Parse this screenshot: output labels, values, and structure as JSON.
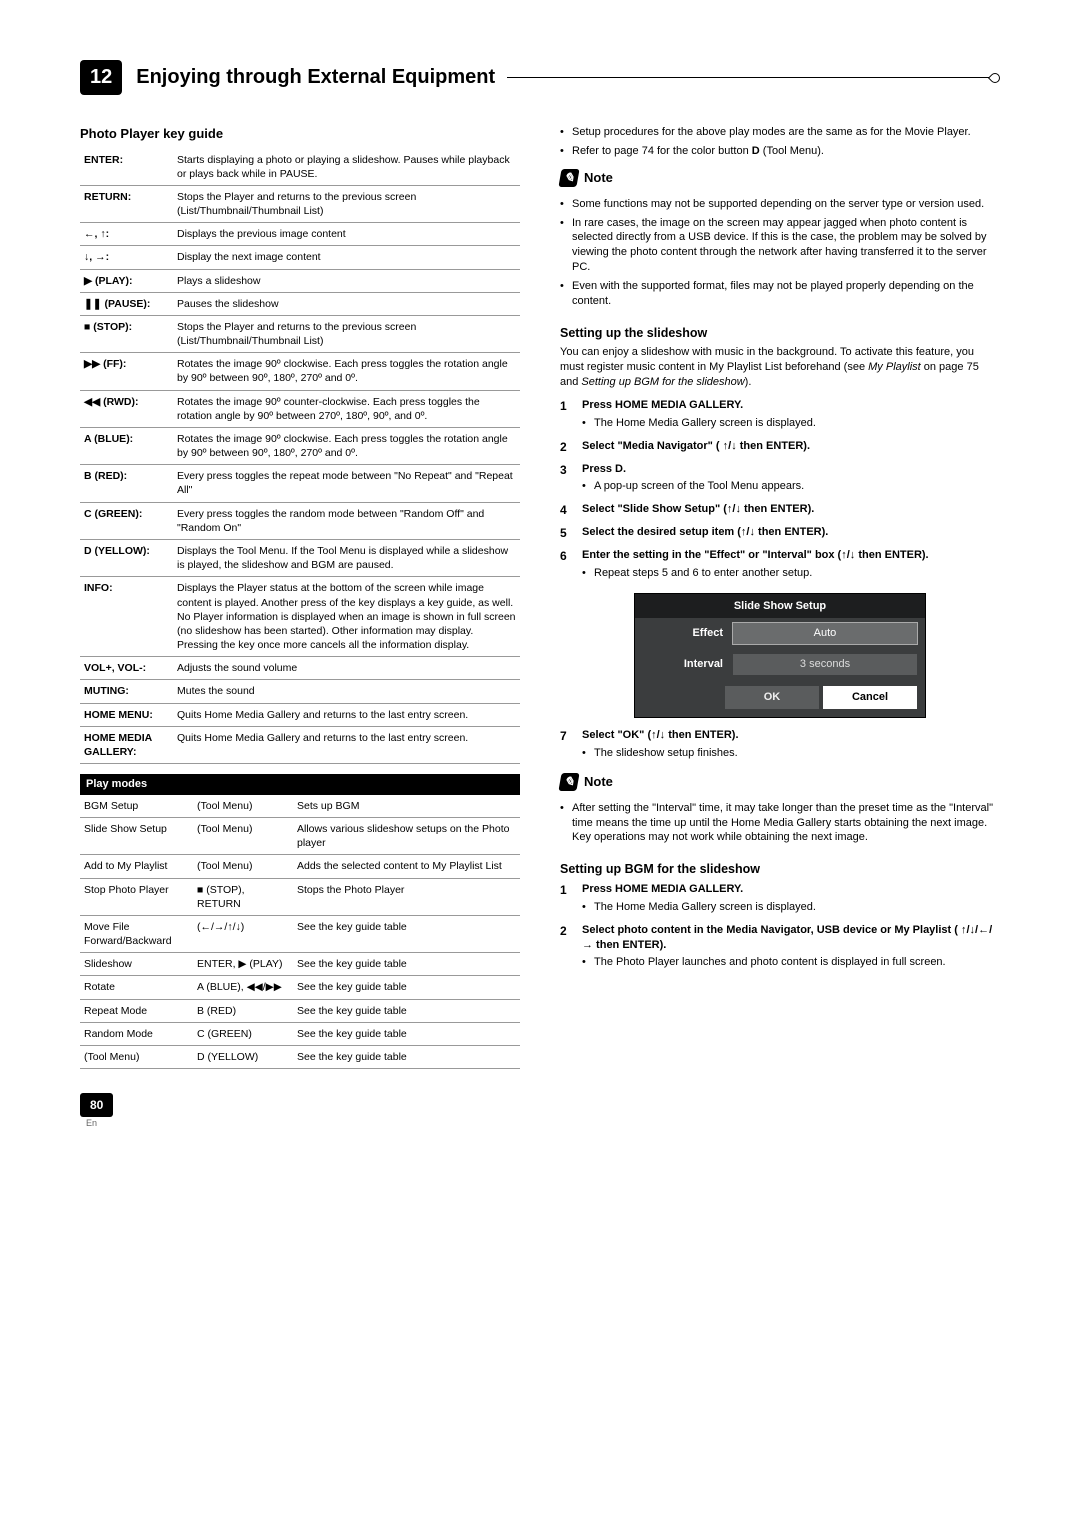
{
  "chapter": {
    "number": "12",
    "title": "Enjoying through External Equipment"
  },
  "left": {
    "keyguide_title": "Photo Player key guide",
    "keys": [
      {
        "k": "ENTER:",
        "v": "Starts displaying a photo or playing a slideshow. Pauses while playback or plays back while in PAUSE."
      },
      {
        "k": "RETURN:",
        "v": "Stops the Player and returns to the previous screen (List/Thumbnail/Thumbnail List)"
      },
      {
        "k": "←, ↑:",
        "v": "Displays the previous image content"
      },
      {
        "k": "↓, →:",
        "v": "Display the next image content"
      },
      {
        "k": "▶ (PLAY):",
        "v": "Plays a slideshow"
      },
      {
        "k": "❚❚ (PAUSE):",
        "v": "Pauses the slideshow"
      },
      {
        "k": "■ (STOP):",
        "v": "Stops the Player and returns to the previous screen (List/Thumbnail/Thumbnail List)"
      },
      {
        "k": "▶▶ (FF):",
        "v": "Rotates the image 90º clockwise. Each press toggles the rotation angle by 90º between 90º, 180º, 270º and 0º."
      },
      {
        "k": "◀◀ (RWD):",
        "v": "Rotates the image 90º counter-clockwise. Each press toggles the rotation angle by 90º between 270º, 180º, 90º, and 0º."
      },
      {
        "k": "A (BLUE):",
        "v": "Rotates the image 90º clockwise. Each press toggles the rotation angle by 90º between 90º, 180º, 270º and 0º."
      },
      {
        "k": "B (RED):",
        "v": "Every press toggles the repeat mode between \"No Repeat\" and \"Repeat All\""
      },
      {
        "k": "C (GREEN):",
        "v": "Every press toggles the random mode between \"Random Off\" and  \"Random On\""
      },
      {
        "k": "D (YELLOW):",
        "v": "Displays the Tool Menu. If the Tool Menu is displayed while a slideshow is played, the slideshow and BGM are paused."
      },
      {
        "k": "INFO:",
        "v": "Displays the Player status at the bottom of the screen while image content is played. Another press of the key displays a key guide, as well. No Player information is displayed when an image is shown in full screen (no slideshow has been started). Other information may display. Pressing the key once more cancels all the information display."
      },
      {
        "k": "VOL+, VOL-:",
        "v": "Adjusts the sound volume"
      },
      {
        "k": "MUTING:",
        "v": "Mutes the sound"
      },
      {
        "k": "HOME MENU:",
        "v": "Quits Home Media Gallery and returns to the last entry screen."
      },
      {
        "k": "HOME MEDIA GALLERY:",
        "v": "Quits Home Media Gallery and returns to the last entry screen."
      }
    ],
    "playmodes_title": "Play modes",
    "playmodes": [
      {
        "a": "BGM Setup",
        "b": "(Tool Menu)",
        "c": "Sets up BGM"
      },
      {
        "a": "Slide Show Setup",
        "b": "(Tool Menu)",
        "c": "Allows various slideshow setups on the Photo player"
      },
      {
        "a": "Add to My Playlist",
        "b": "(Tool Menu)",
        "c": "Adds the selected content to My Playlist List"
      },
      {
        "a": "Stop Photo Player",
        "b": "■ (STOP), RETURN",
        "bc": "bold",
        "c": "Stops the Photo Player"
      },
      {
        "a": "Move File Forward/Backward",
        "b": "(←/→/↑/↓)",
        "c": "See the key guide table"
      },
      {
        "a": "Slideshow",
        "b": "ENTER, ▶ (PLAY)",
        "bc": "bold",
        "c": "See the key guide table"
      },
      {
        "a": "Rotate",
        "b": "A (BLUE), ◀◀/▶▶",
        "bc": "bold",
        "c": "See the key guide table"
      },
      {
        "a": "Repeat Mode",
        "b": "B (RED)",
        "bc": "bold",
        "c": "See the key guide table"
      },
      {
        "a": "Random Mode",
        "b": "C (GREEN)",
        "bc": "bold",
        "c": "See the key guide table"
      },
      {
        "a": "(Tool Menu)",
        "b": "D (YELLOW)",
        "bc": "bold",
        "c": "See the key guide table"
      }
    ]
  },
  "right": {
    "top_bullets": [
      "Setup procedures for the above play modes are the same as for the Movie Player.",
      "Refer to page 74 for the color button <b>D</b> (Tool Menu)."
    ],
    "note1_label": "Note",
    "note1_bullets": [
      "Some functions may not be supported depending on the server type or version used.",
      "In rare cases, the image on the screen may appear jagged when photo content is selected directly from a USB device. If this is the case, the problem may be solved by viewing the photo content through the network after having transferred it to the server PC.",
      "Even with the supported format, files may not be played properly depending on the content."
    ],
    "slideshow_heading": "Setting up the slideshow",
    "slideshow_intro": "You can enjoy a slideshow with music in the background. To activate this feature, you must register music content in My Playlist List beforehand (see <i>My Playlist</i> on page 75 and <i>Setting up BGM for the slideshow</i>).",
    "slideshow_steps": [
      {
        "t": "Press HOME MEDIA GALLERY.",
        "sub": "The Home Media Gallery screen is displayed."
      },
      {
        "t": "Select \"Media Navigator\" ( ↑/↓ then ENTER)."
      },
      {
        "t": "Press D.",
        "sub": "A pop-up screen of the Tool Menu appears."
      },
      {
        "t": "Select \"Slide Show Setup\" (↑/↓ then ENTER)."
      },
      {
        "t": "Select the desired setup item (↑/↓ then ENTER)."
      },
      {
        "t": "Enter the setting in the \"Effect\" or \"Interval\" box (↑/↓ then ENTER).",
        "sub": "Repeat steps 5 and 6 to enter another setup."
      }
    ],
    "setup_box": {
      "title": "Slide Show Setup",
      "rows": [
        {
          "label": "Effect",
          "value": "Auto",
          "hl": true
        },
        {
          "label": "Interval",
          "value": "3 seconds"
        }
      ],
      "ok": "OK",
      "cancel": "Cancel"
    },
    "step7": {
      "t": "Select \"OK\"  (↑/↓ then ENTER).",
      "sub": "The slideshow setup finishes."
    },
    "note2_label": "Note",
    "note2_bullets": [
      "After setting the \"Interval\" time, it may take longer than the preset time as the \"Interval\" time means the time up until the Home Media Gallery starts obtaining the next image. Key operations may not work while obtaining the next image."
    ],
    "bgm_heading": "Setting up BGM for the slideshow",
    "bgm_steps": [
      {
        "t": "Press HOME MEDIA GALLERY.",
        "sub": "The Home Media Gallery screen is displayed."
      },
      {
        "t": "Select photo content in the Media Navigator, USB device or My Playlist ( ↑/↓/←/→ then ENTER).",
        "sub": "The Photo Player launches and photo content is displayed in full screen."
      }
    ]
  },
  "page": {
    "number": "80",
    "lang": "En"
  }
}
